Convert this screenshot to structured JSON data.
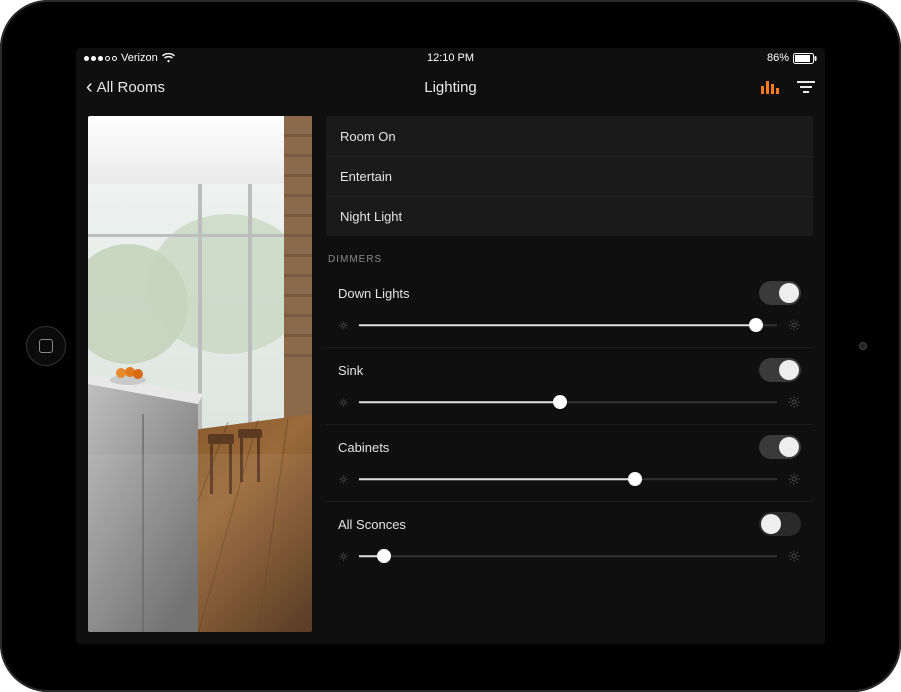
{
  "status_bar": {
    "carrier": "Verizon",
    "signal_strength": 3,
    "signal_max": 5,
    "time": "12:10 PM",
    "battery_pct": "86%"
  },
  "nav": {
    "back_label": "All Rooms",
    "title": "Lighting"
  },
  "scenes": [
    {
      "label": "Room On"
    },
    {
      "label": "Entertain"
    },
    {
      "label": "Night Light"
    }
  ],
  "section_label": "DIMMERS",
  "dimmers": [
    {
      "name": "Down Lights",
      "on": true,
      "level": 95
    },
    {
      "name": "Sink",
      "on": true,
      "level": 48
    },
    {
      "name": "Cabinets",
      "on": true,
      "level": 66
    },
    {
      "name": "All Sconces",
      "on": false,
      "level": 6
    }
  ],
  "accent_color": "#ff7a1a"
}
